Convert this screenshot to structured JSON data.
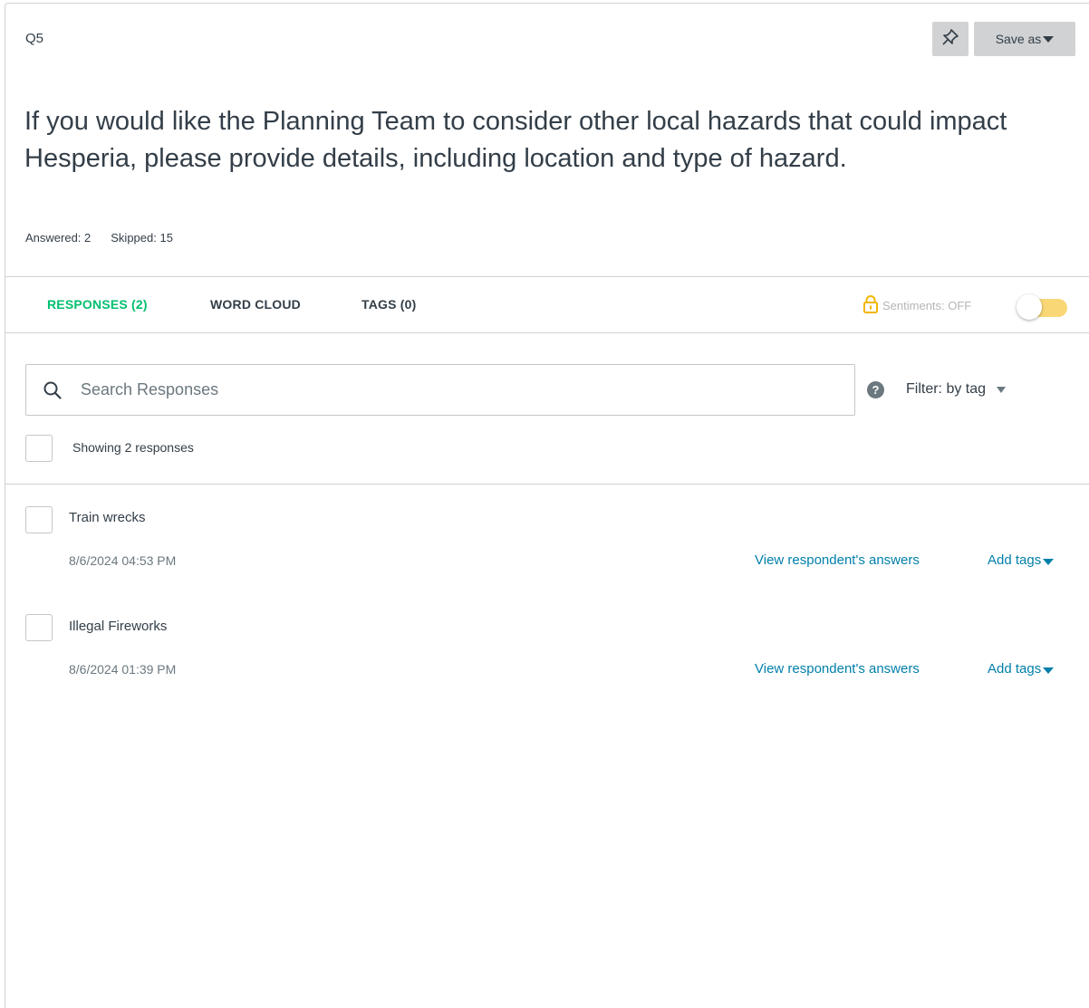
{
  "question": {
    "number": "Q5",
    "text": "If you would like the Planning Team to consider other local hazards that could impact Hesperia, please provide details, including location and type of hazard.",
    "answered": "Answered: 2",
    "skipped": "Skipped: 15"
  },
  "toolbar": {
    "pin_icon": "pin-icon",
    "save_as_label": "Save as"
  },
  "tabs": [
    {
      "label": "RESPONSES (2)",
      "active": true
    },
    {
      "label": "WORD CLOUD",
      "active": false
    },
    {
      "label": "TAGS (0)",
      "active": false
    }
  ],
  "sentiments": {
    "label": "Sentiments: OFF",
    "enabled": false
  },
  "search": {
    "placeholder": "Search Responses",
    "value": ""
  },
  "filter": {
    "label": "Filter: by tag"
  },
  "showing": "Showing 2 responses",
  "responses": [
    {
      "text": "Train wrecks",
      "date": "8/6/2024 04:53 PM",
      "view_link": "View respondent's answers",
      "tags_link": "Add tags"
    },
    {
      "text": "Illegal Fireworks",
      "date": "8/6/2024 01:39 PM",
      "view_link": "View respondent's answers",
      "tags_link": "Add tags"
    }
  ],
  "colors": {
    "accent": "#00bf6f",
    "link": "#007faa",
    "toggle_track": "#f9d776",
    "lock": "#f2b600"
  }
}
